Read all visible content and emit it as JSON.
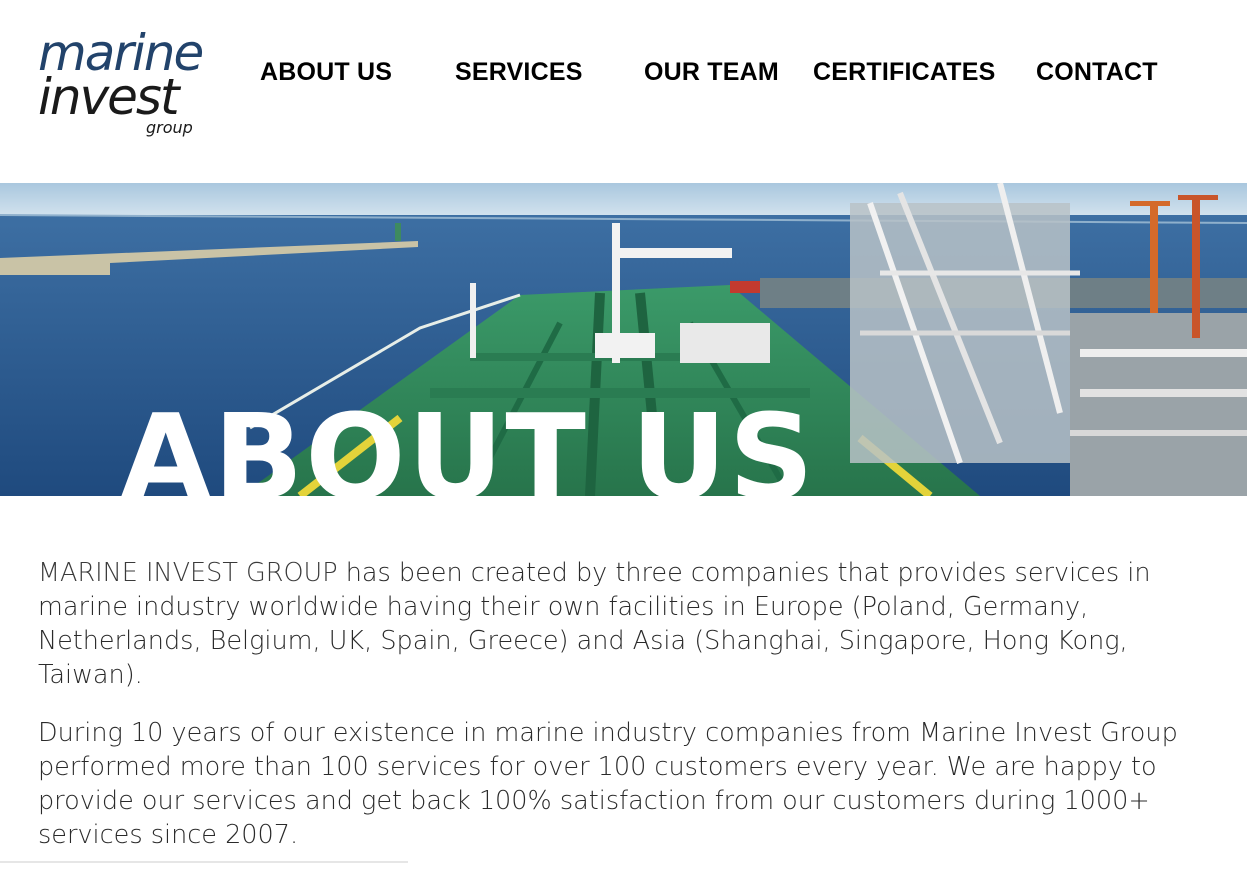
{
  "logo": {
    "line1": "marine",
    "line2": "invest",
    "line3": "group"
  },
  "nav": {
    "items": [
      {
        "label": "ABOUT US"
      },
      {
        "label": "SERVICES"
      },
      {
        "label": "OUR TEAM"
      },
      {
        "label": "CERTIFICATES"
      },
      {
        "label": "CONTACT"
      }
    ]
  },
  "hero": {
    "title": "ABOUT US"
  },
  "content": {
    "p1_company": "MARINE INVEST GROUP",
    "p1_rest": " has been created by three companies that provides services in marine industry worldwide having their own facilities in Europe (Poland, Germany, Netherlands, Belgium, UK, Spain, Greece) and Asia (Shanghai, Singapore, Hong Kong, Taiwan).",
    "p2": "During 10 years of our existence in marine industry companies from Marine Invest Group performed more than 100 services for over 100 customers every year. We are happy to provide our services and get back 100% satisfaction from our customers during 1000+ services since 2007."
  },
  "colors": {
    "logo_blue": "#22436b",
    "sea": "#2f5f93",
    "deck_green": "#2f8a5b"
  }
}
